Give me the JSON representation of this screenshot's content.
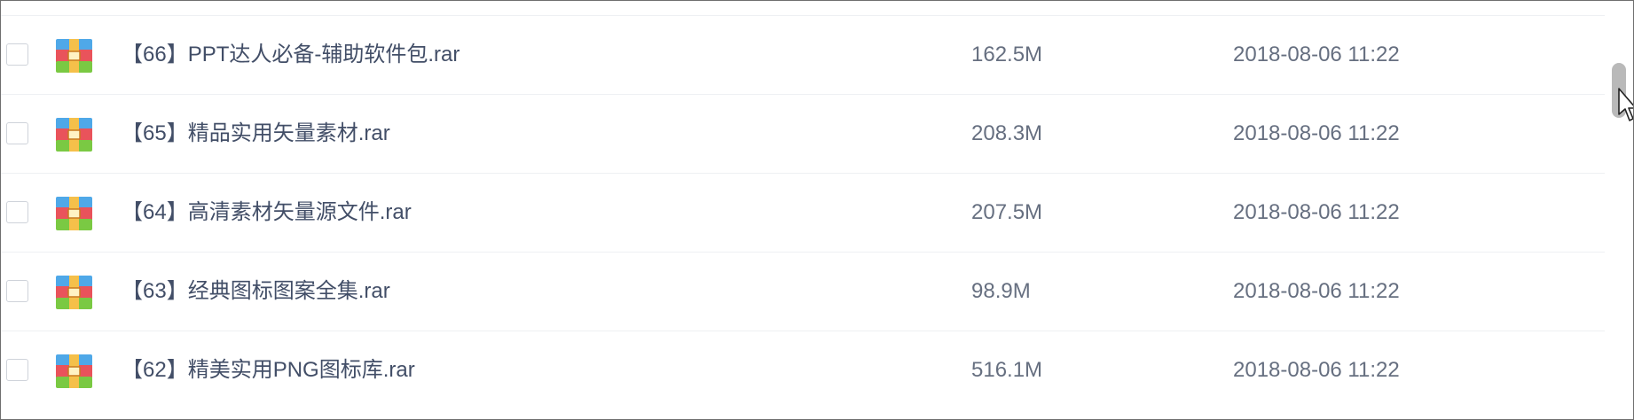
{
  "files": [
    {
      "name": "【66】PPT达人必备-辅助软件包.rar",
      "size": "162.5M",
      "date": "2018-08-06 11:22",
      "icon": "rar-archive-icon"
    },
    {
      "name": "【65】精品实用矢量素材.rar",
      "size": "208.3M",
      "date": "2018-08-06 11:22",
      "icon": "rar-archive-icon"
    },
    {
      "name": "【64】高清素材矢量源文件.rar",
      "size": "207.5M",
      "date": "2018-08-06 11:22",
      "icon": "rar-archive-icon"
    },
    {
      "name": "【63】经典图标图案全集.rar",
      "size": "98.9M",
      "date": "2018-08-06 11:22",
      "icon": "rar-archive-icon"
    },
    {
      "name": "【62】精美实用PNG图标库.rar",
      "size": "516.1M",
      "date": "2018-08-06 11:22",
      "icon": "rar-archive-icon"
    }
  ],
  "colors": {
    "icon_top": "#4fa8e8",
    "icon_middle": "#e9535b",
    "icon_bottom": "#7ac943",
    "icon_strap": "#f5c04a",
    "text_name": "#424e67",
    "text_meta": "#666f80",
    "scroll_thumb": "#b9b9b9"
  }
}
